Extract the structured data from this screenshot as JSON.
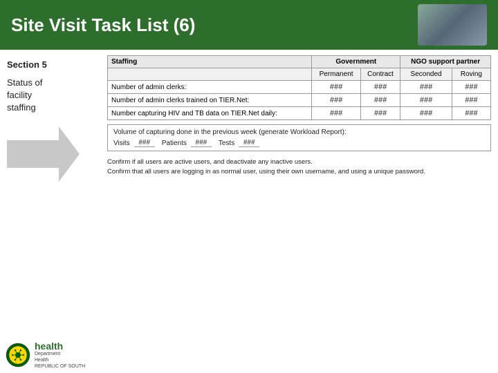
{
  "header": {
    "title": "Site Visit Task List (6)"
  },
  "sidebar": {
    "section_label": "Section 5",
    "description_line1": "Status of",
    "description_line2": "facility",
    "description_line3": "staffing"
  },
  "table": {
    "col_header_staffing": "Staffing",
    "col_group_government": "Government",
    "col_group_ngo": "NGO support partner",
    "col_permanent": "Permanent",
    "col_contract": "Contract",
    "col_seconded": "Seconded",
    "col_roving": "Roving",
    "rows": [
      {
        "label": "Number of admin clerks:",
        "permanent": "###",
        "contract": "###",
        "seconded": "###",
        "roving": "###"
      },
      {
        "label": "Number of admin clerks trained on TIER.Net:",
        "permanent": "###",
        "contract": "###",
        "seconded": "###",
        "roving": "###"
      },
      {
        "label": "Number capturing HIV and TB data on TIER.Net daily:",
        "permanent": "###",
        "contract": "###",
        "seconded": "###",
        "roving": "###"
      }
    ]
  },
  "volume": {
    "label": "Volume of capturing done in the previous week (generate Workload Report):",
    "visits_label": "Visits",
    "visits_value": "###",
    "patients_label": "Patients",
    "patients_value": "###",
    "tests_label": "Tests",
    "tests_value": "###"
  },
  "confirm": {
    "line1": "Confirm if all users are active users, and deactivate any inactive users.",
    "line2": "Confirm that all users are logging in as normal user, using their own username, and using a unique password."
  },
  "logo": {
    "health": "health",
    "dept_line1": "Department:",
    "dept_line2": "Health",
    "republic": "REPUBLIC OF SOUTH"
  }
}
